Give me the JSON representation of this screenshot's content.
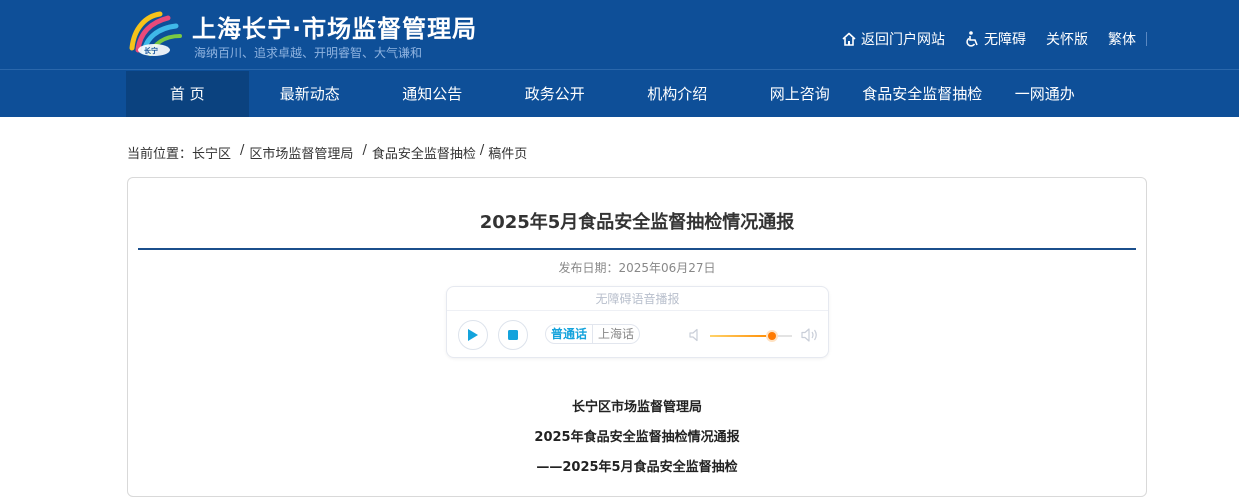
{
  "header": {
    "title": "上海长宁·市场监督管理局",
    "slogan": "海纳百川、追求卓越、开明睿智、大气谦和",
    "links": {
      "portal": "返回门户网站",
      "accessibility": "无障碍",
      "care": "关怀版",
      "traditional": "繁体"
    }
  },
  "nav": {
    "items": [
      "首 页",
      "最新动态",
      "通知公告",
      "政务公开",
      "机构介绍",
      "网上咨询",
      "食品安全监督抽检",
      "一网通办"
    ]
  },
  "breadcrumb": {
    "prefix": "当前位置：",
    "items": [
      "长宁区",
      "区市场监督管理局",
      "食品安全监督抽检",
      "稿件页"
    ],
    "separator": "/"
  },
  "article": {
    "title": "2025年5月食品安全监督抽检情况通报",
    "date": "发布日期：2025年06月27日",
    "body_lines": [
      "长宁区市场监督管理局",
      "2025年食品安全监督抽检情况通报",
      "——2025年5月食品安全监督抽检"
    ]
  },
  "player": {
    "label": "无障碍语音播报",
    "lang_mandarin": "普通话",
    "lang_shanghai": "上海话",
    "selected_lang": "普通话",
    "volume": 0.75
  },
  "colors": {
    "header_bg": "#0e4f98",
    "nav_active_bg": "#0b427f",
    "accent": "#14a3dc",
    "title_rule": "#1b4f8c",
    "volume": "#ff7a00"
  },
  "icons": [
    "logo-icon",
    "home-icon",
    "wheelchair-icon",
    "play-icon",
    "stop-icon",
    "volume-low-icon",
    "volume-high-icon"
  ]
}
